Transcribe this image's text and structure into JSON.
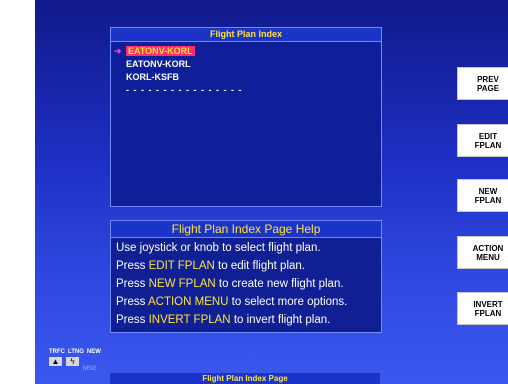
{
  "index": {
    "title": "Flight Plan Index",
    "plans": [
      {
        "label": "EATONV-KORL",
        "selected": true
      },
      {
        "label": "EATONV-KORL",
        "selected": false
      },
      {
        "label": "KORL-KSFB",
        "selected": false
      }
    ],
    "empty_slot": "- - - - - - - - - - - - - - - -"
  },
  "help": {
    "title": "Flight Plan Index Page Help",
    "line1": "Use joystick or knob to select flight plan.",
    "line2_pre": "Press ",
    "line2_key": "EDIT FPLAN",
    "line2_post": " to edit flight plan.",
    "line3_pre": "Press ",
    "line3_key": "NEW FPLAN",
    "line3_post": " to create new flight plan.",
    "line4_pre": "Press ",
    "line4_key": "ACTION MENU",
    "line4_post": " to select more options.",
    "line5_pre": "Press ",
    "line5_key": "INVERT FPLAN",
    "line5_post": " to invert flight plan."
  },
  "softkeys": {
    "prev": {
      "l1": "PREV",
      "l2": "PAGE"
    },
    "edit": {
      "l1": "EDIT",
      "l2": "FPLAN"
    },
    "new": {
      "l1": "NEW",
      "l2": "FPLAN"
    },
    "action": {
      "l1": "ACTION",
      "l2": "MENU"
    },
    "invert": {
      "l1": "INVERT",
      "l2": "FPLAN"
    }
  },
  "status": {
    "trfc": "TRFC",
    "ltng": "LTNG",
    "new": "NEW",
    "msg": "MSG"
  },
  "footer": "Flight Plan Index Page",
  "colors": {
    "screen_top": "#101a8a",
    "screen_bottom": "#3b58ee",
    "highlight_text": "#ffe23a",
    "selection": "#ff2e6a"
  }
}
